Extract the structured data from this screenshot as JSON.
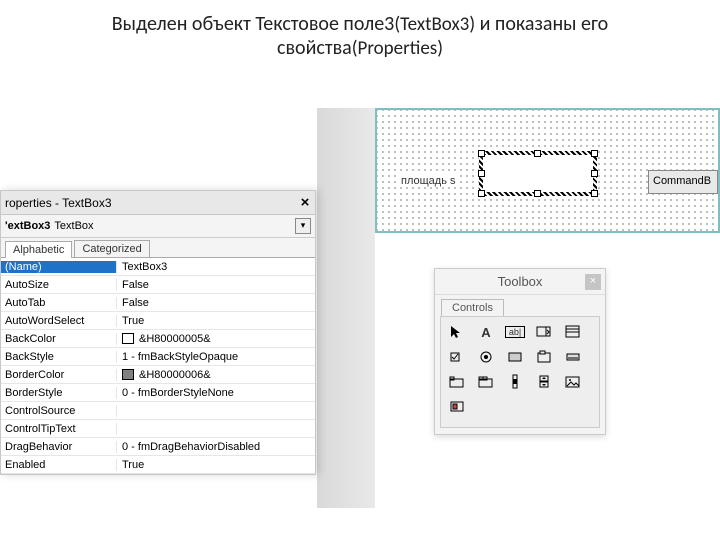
{
  "title_part1": "Выделен объект Текстовое поле3",
  "title_part2": "(TextBox3)",
  "title_part3": " и показаны его свойства",
  "title_part4": "(Properties)",
  "form": {
    "label": "площадь s",
    "button": "CommandB"
  },
  "properties": {
    "window_title": "roperties - TextBox3",
    "selector_name": "'extBox3",
    "selector_type": "TextBox",
    "tabs": {
      "alphabetic": "Alphabetic",
      "categorized": "Categorized"
    },
    "rows": [
      {
        "name": "(Name)",
        "value": "TextBox3",
        "selected": true
      },
      {
        "name": "AutoSize",
        "value": "False"
      },
      {
        "name": "AutoTab",
        "value": "False"
      },
      {
        "name": "AutoWordSelect",
        "value": "True"
      },
      {
        "name": "BackColor",
        "value": "&H80000005&",
        "swatch": "white"
      },
      {
        "name": "BackStyle",
        "value": "1 - fmBackStyleOpaque"
      },
      {
        "name": "BorderColor",
        "value": "&H80000006&",
        "swatch": "gray"
      },
      {
        "name": "BorderStyle",
        "value": "0 - fmBorderStyleNone"
      },
      {
        "name": "ControlSource",
        "value": ""
      },
      {
        "name": "ControlTipText",
        "value": ""
      },
      {
        "name": "DragBehavior",
        "value": "0 - fmDragBehaviorDisabled"
      },
      {
        "name": "Enabled",
        "value": "True"
      }
    ]
  },
  "toolbox": {
    "title": "Toolbox",
    "tab": "Controls"
  }
}
